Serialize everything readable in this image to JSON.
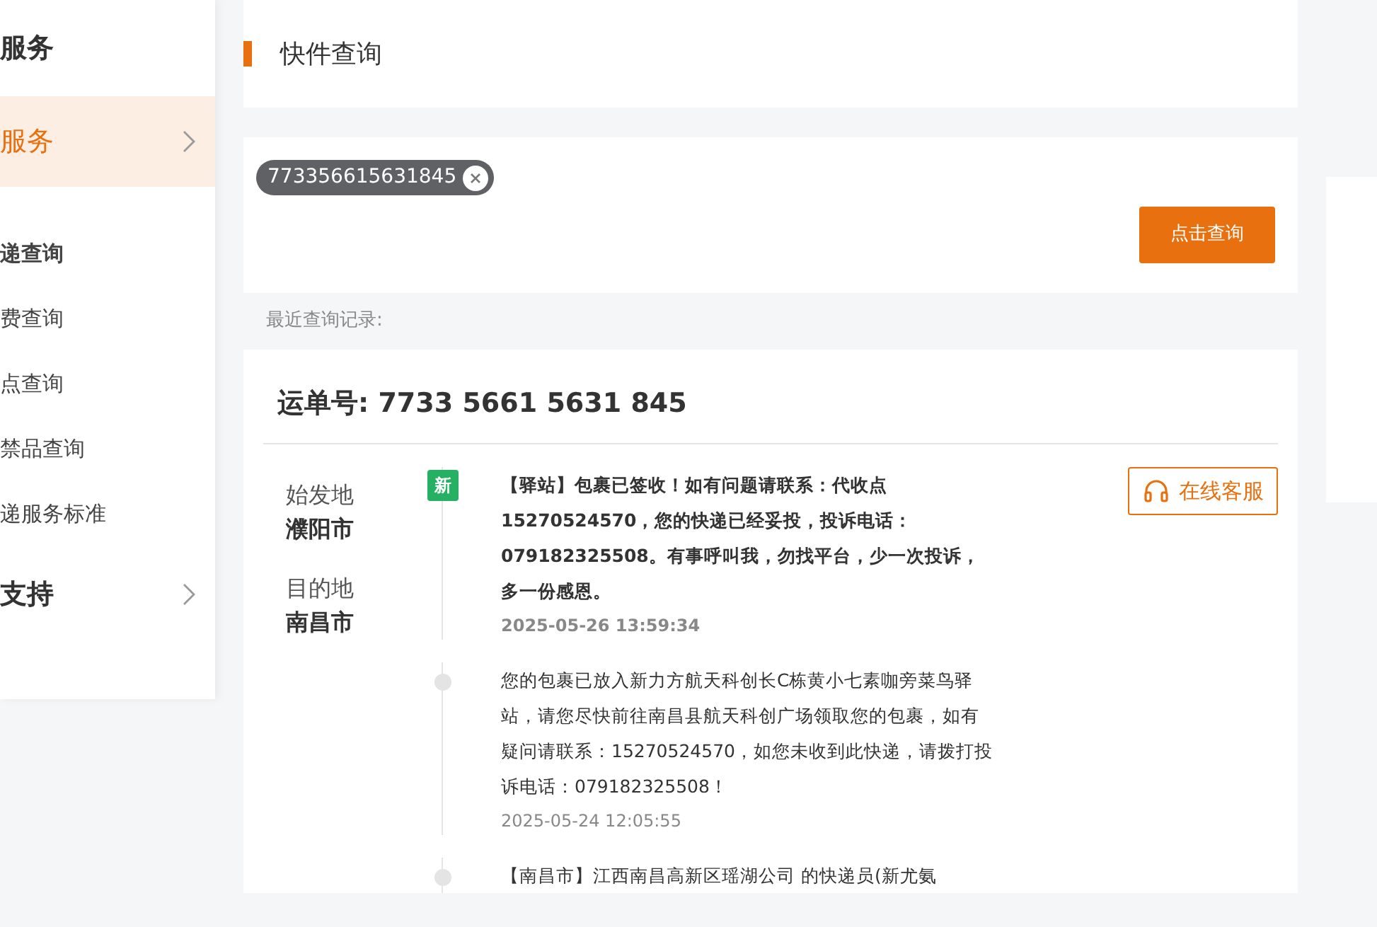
{
  "sidebar": {
    "groups": [
      {
        "title": "服务",
        "selected": false,
        "expandable": false
      },
      {
        "title": "服务",
        "selected": true,
        "expandable": true,
        "items": [
          {
            "label": "递查询",
            "selected": true
          },
          {
            "label": "费查询",
            "selected": false
          },
          {
            "label": "点查询",
            "selected": false
          },
          {
            "label": "禁品查询",
            "selected": false
          },
          {
            "label": "递服务标准",
            "selected": false
          }
        ]
      },
      {
        "title": "支持",
        "selected": false,
        "expandable": true
      }
    ]
  },
  "page_title": "快件查询",
  "search": {
    "tags": [
      "773356615631845"
    ],
    "button": "点击查询"
  },
  "recent_label": "最近查询记录:",
  "result": {
    "waybill_label": "运单号",
    "waybill_number": ": 7733 5661 5631 845",
    "origin_label": "始发地",
    "origin": "濮阳市",
    "destination_label": "目的地",
    "destination": "南昌市",
    "support_button": "在线客服",
    "events": [
      {
        "latest": true,
        "badge": "新",
        "text": "【驿站】包裹已签收！如有问题请联系：代收点15270524570，您的快递已经妥投，投诉电话：079182325508。有事呼叫我，勿找平台，少一次投诉，多一份感恩。",
        "time": "2025-05-26 13:59:34"
      },
      {
        "latest": false,
        "text": "您的包裹已放入新力方航天科创长C栋黄小七素咖旁菜鸟驿站，请您尽快前往南昌县航天科创广场领取您的包裹，如有疑问请联系：15270524570，如您未收到此快递，请拨打投诉电话：079182325508！",
        "time": "2025-05-24 12:05:55"
      },
      {
        "latest": false,
        "text": "【南昌市】江西南昌高新区瑶湖公司 的快递员(新尤氨"
      }
    ]
  }
}
